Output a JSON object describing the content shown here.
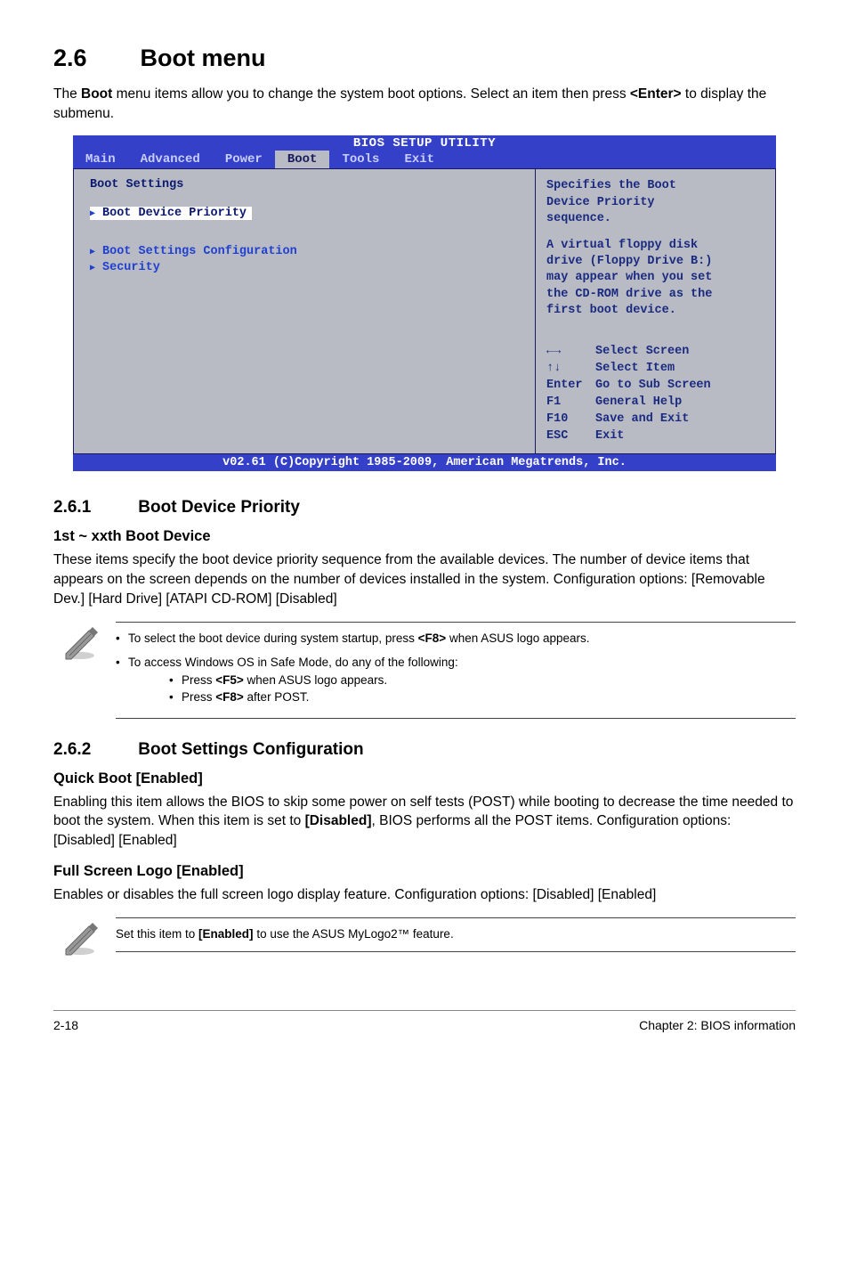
{
  "header": {
    "section_number": "2.6",
    "section_title": "Boot menu",
    "intro_text_1": "The ",
    "intro_bold_1": "Boot",
    "intro_text_2": " menu items allow you to change the system boot options. Select an item then press ",
    "intro_bold_2": "<Enter>",
    "intro_text_3": " to display the submenu."
  },
  "bios": {
    "title": "BIOS SETUP UTILITY",
    "tabs": [
      "Main",
      "Advanced",
      "Power",
      "Boot",
      "Tools",
      "Exit"
    ],
    "selected_tab": 3,
    "left": {
      "heading": "Boot Settings",
      "items": [
        {
          "label": "Boot Device Priority",
          "selected": true
        },
        {
          "label": "Boot Settings Configuration",
          "selected": false
        },
        {
          "label": "Security",
          "selected": false
        }
      ]
    },
    "right": {
      "help_line1": "Specifies the Boot",
      "help_line2": "Device Priority",
      "help_line3": "sequence.",
      "help_mid1": "A virtual floppy disk",
      "help_mid2": "drive (Floppy Drive B:)",
      "help_mid3": "may appear when you set",
      "help_mid4": "the CD-ROM drive as the",
      "help_mid5": "first boot device.",
      "keys": [
        {
          "k": "←→",
          "v": "Select Screen"
        },
        {
          "k": "↑↓",
          "v": "Select Item"
        },
        {
          "k": "Enter",
          "v": "Go to Sub Screen"
        },
        {
          "k": "F1",
          "v": "General Help"
        },
        {
          "k": "F10",
          "v": "Save and Exit"
        },
        {
          "k": "ESC",
          "v": "Exit"
        }
      ]
    },
    "footer": "v02.61 (C)Copyright 1985-2009, American Megatrends, Inc."
  },
  "sub261": {
    "num": "2.6.1",
    "title": "Boot Device Priority",
    "heading1": "1st ~ xxth Boot Device",
    "para": "These items specify the boot device priority sequence from the available devices. The number of device items that appears on the screen depends on the number of devices installed in the system. Configuration options: [Removable Dev.] [Hard Drive] [ATAPI CD-ROM] [Disabled]"
  },
  "note1": {
    "bullet1_a": "To select the boot device during system startup, press ",
    "bullet1_b": "<F8>",
    "bullet1_c": " when ASUS logo appears.",
    "bullet2": "To access Windows OS in Safe Mode, do any of the following:",
    "sub1_a": "Press ",
    "sub1_b": "<F5>",
    "sub1_c": " when ASUS logo appears.",
    "sub2_a": "Press ",
    "sub2_b": "<F8>",
    "sub2_c": " after POST."
  },
  "sub262": {
    "num": "2.6.2",
    "title": "Boot Settings Configuration",
    "h1": "Quick Boot [Enabled]",
    "p1_a": "Enabling this item allows the BIOS to skip some power on self tests (POST) while booting to decrease the time needed to boot the system. When this item is set to ",
    "p1_b": "[Disabled]",
    "p1_c": ", BIOS performs all the POST items. Configuration options: [Disabled] [Enabled]",
    "h2": "Full Screen Logo [Enabled]",
    "p2": "Enables or disables the full screen logo display feature. Configuration options: [Disabled] [Enabled]"
  },
  "note2": {
    "text_a": "Set this item to ",
    "text_b": "[Enabled]",
    "text_c": " to use the ASUS MyLogo2™ feature."
  },
  "footer": {
    "left": "2-18",
    "right": "Chapter 2: BIOS information"
  }
}
